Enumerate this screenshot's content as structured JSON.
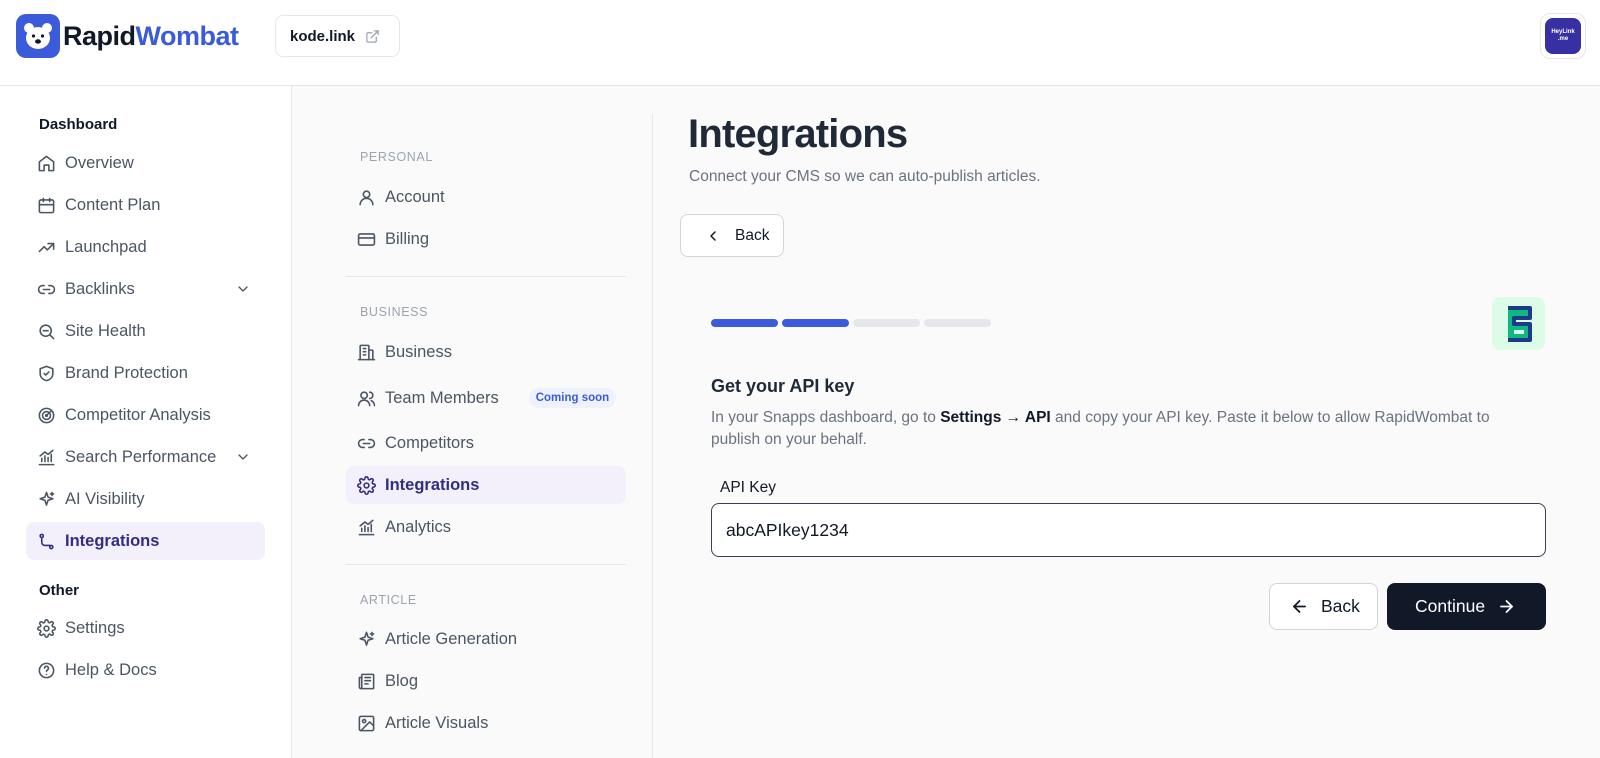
{
  "header": {
    "brand_part1": "Rapid",
    "brand_part2": "Wombat",
    "site_name": "kode.link",
    "avatar_text_1": "HeyLink",
    "avatar_text_2": ".me"
  },
  "sidebar": {
    "section_dashboard": "Dashboard",
    "section_other": "Other",
    "items": [
      {
        "label": "Overview",
        "icon": "home-icon"
      },
      {
        "label": "Content Plan",
        "icon": "calendar-icon"
      },
      {
        "label": "Launchpad",
        "icon": "trending-up-icon"
      },
      {
        "label": "Backlinks",
        "icon": "link-icon",
        "expandable": true
      },
      {
        "label": "Site Health",
        "icon": "search-scan-icon"
      },
      {
        "label": "Brand Protection",
        "icon": "shield-check-icon"
      },
      {
        "label": "Competitor Analysis",
        "icon": "radar-icon"
      },
      {
        "label": "Search Performance",
        "icon": "chart-icon",
        "expandable": true
      },
      {
        "label": "AI Visibility",
        "icon": "sparkles-icon"
      },
      {
        "label": "Integrations",
        "icon": "route-icon",
        "active": true
      }
    ],
    "other_items": [
      {
        "label": "Settings",
        "icon": "gear-icon"
      },
      {
        "label": "Help & Docs",
        "icon": "help-icon"
      }
    ]
  },
  "settings_menu": {
    "personal_label": "PERSONAL",
    "business_label": "BUSINESS",
    "article_label": "ARTICLE",
    "personal": [
      {
        "label": "Account",
        "icon": "user-icon"
      },
      {
        "label": "Billing",
        "icon": "credit-card-icon"
      }
    ],
    "business": [
      {
        "label": "Business",
        "icon": "building-icon"
      },
      {
        "label": "Team Members",
        "icon": "users-icon",
        "badge": "Coming soon"
      },
      {
        "label": "Competitors",
        "icon": "link-icon"
      },
      {
        "label": "Integrations",
        "icon": "gear-icon",
        "active": true
      },
      {
        "label": "Analytics",
        "icon": "chart-icon"
      }
    ],
    "article": [
      {
        "label": "Article Generation",
        "icon": "sparkles-icon"
      },
      {
        "label": "Blog",
        "icon": "newspaper-icon"
      },
      {
        "label": "Article Visuals",
        "icon": "image-icon"
      }
    ]
  },
  "main": {
    "title": "Integrations",
    "subtitle": "Connect your CMS so we can auto-publish articles.",
    "back_top_label": "Back",
    "progress": {
      "current_step": 2,
      "total_steps": 4
    },
    "step_title": "Get your API key",
    "step_desc_pre": "In your Snapps dashboard, go to ",
    "step_desc_bold": "Settings → API",
    "step_desc_post": " and copy your API key. Paste it below to allow RapidWombat to publish on your behalf.",
    "field_label": "API Key",
    "api_key_value": "abcAPIkey1234",
    "back_label": "Back",
    "continue_label": "Continue"
  },
  "colors": {
    "accent": "#3b5bdb",
    "active_bg": "#f3f0fb",
    "active_text": "#312e81",
    "primary_button": "#111827",
    "progress_inactive": "#e5e7eb"
  }
}
